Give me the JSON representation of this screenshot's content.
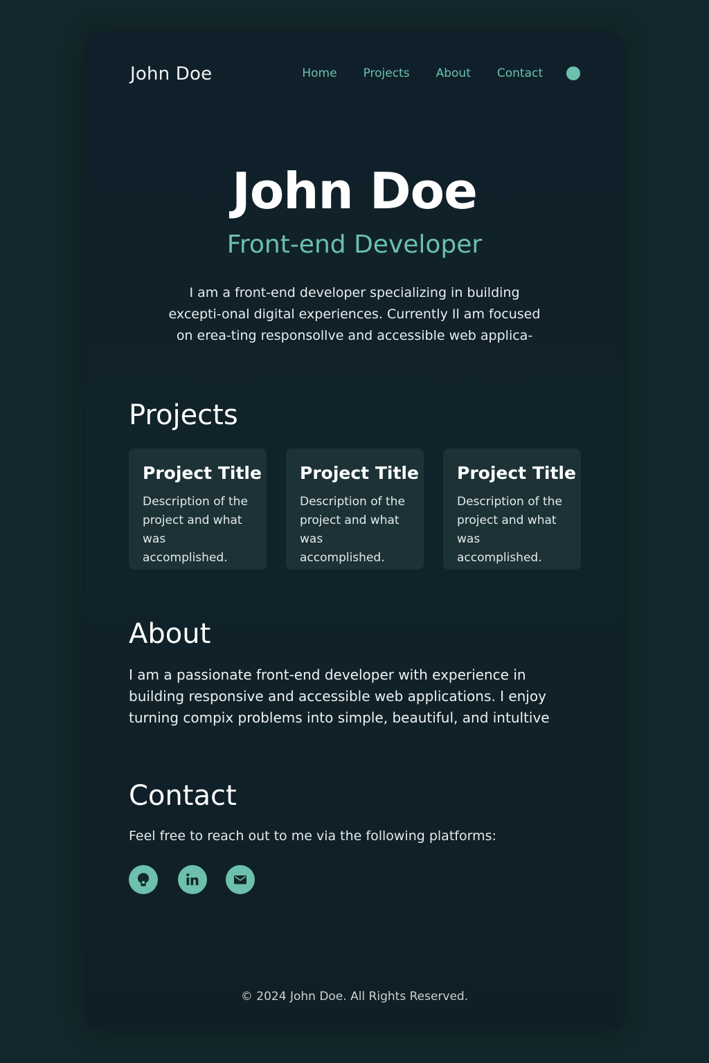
{
  "colors": {
    "accent": "#6cc0ad",
    "page_background": "#13282c",
    "card_background": "#1c3237",
    "icon_glyph": "#12282c"
  },
  "header": {
    "brand": "John Doe",
    "nav": [
      {
        "label": "Home"
      },
      {
        "label": "Projects"
      },
      {
        "label": "About"
      },
      {
        "label": "Contact"
      }
    ],
    "theme_toggle_icon": "circle-dot-icon"
  },
  "hero": {
    "title": "John Doe",
    "subtitle": "Front-end Developer",
    "text": "I am a front-end developer specializing in building excepti-onal digital experiences. Currently Il am focused on erea-ting responsollve and accessible web applica-"
  },
  "projects": {
    "heading": "Projects",
    "items": [
      {
        "title": "Project Title",
        "description": "Description of the project and what was accomplished."
      },
      {
        "title": "Project Title",
        "description": "Description of the project and what was accomplished."
      },
      {
        "title": "Project Title",
        "description": "Description of the project and what was accomplished."
      }
    ]
  },
  "about": {
    "heading": "About",
    "text": "I am a passionate front-end developer with experience in building responsive and accessible web applications. I enjoy turning compix problems into simple, beautiful, and intultive"
  },
  "contact": {
    "heading": "Contact",
    "text": "Feel free to reach out to me via the following platforms:",
    "socials": [
      {
        "icon": "github-icon"
      },
      {
        "icon": "linkedin-icon"
      },
      {
        "icon": "mail-icon"
      }
    ]
  },
  "footer": {
    "text": "© 2024 John Doe. All Rights Reserved."
  }
}
